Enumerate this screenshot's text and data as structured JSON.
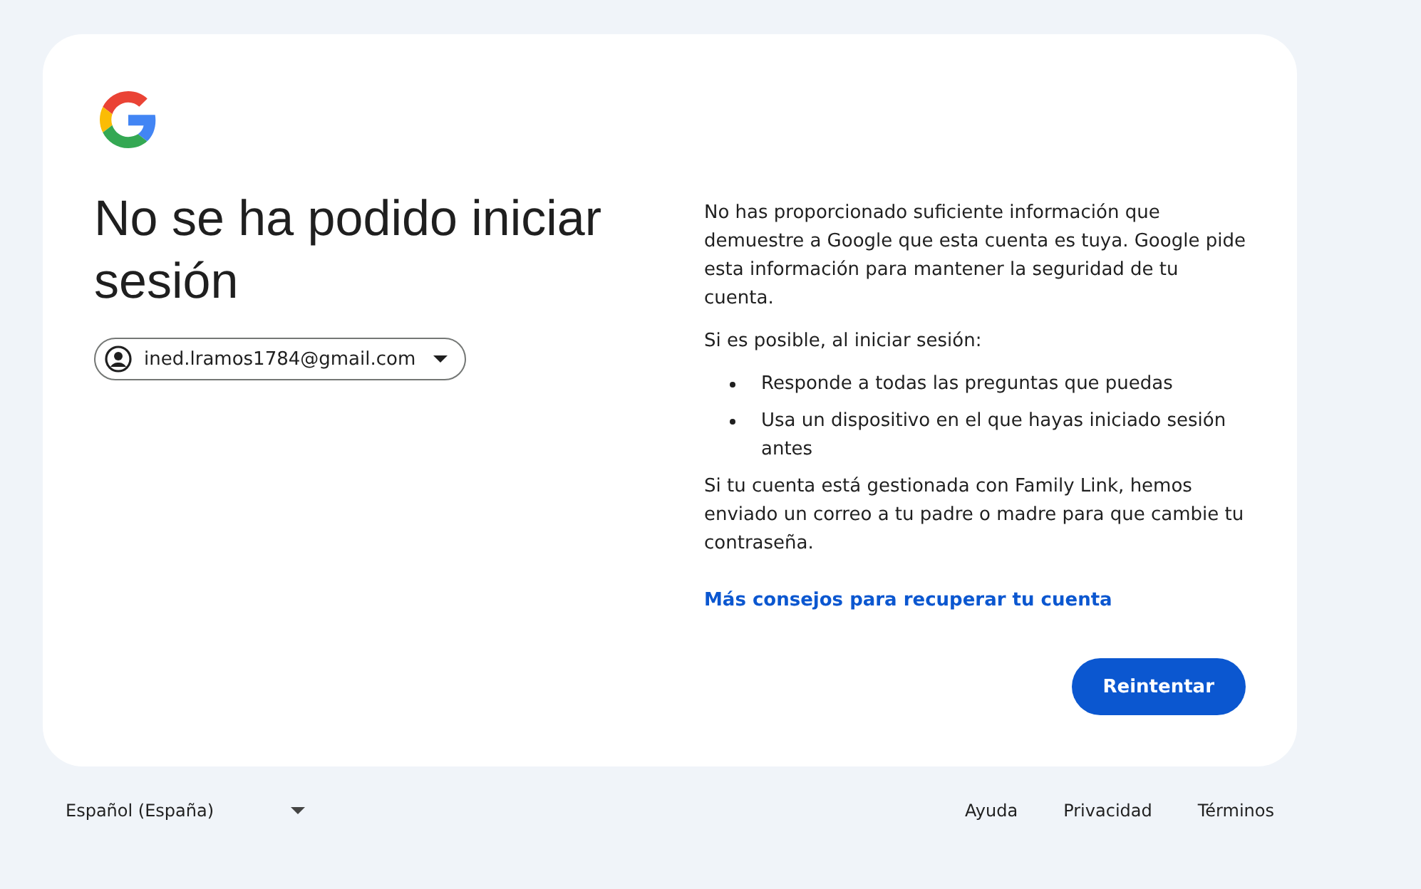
{
  "heading": "No se ha podido iniciar sesión",
  "account": {
    "email": "ined.lramos1784@gmail.com"
  },
  "intro": "No has proporcionado suficiente información que demuestre a Google que esta cuenta es tuya. Google pide esta información para mantener la seguridad de tu cuenta.",
  "tips_title": "Si es posible, al iniciar sesión:",
  "tips": [
    "Responde a todas las preguntas que puedas",
    "Usa un dispositivo en el que hayas iniciado sesión antes"
  ],
  "family_note": "Si tu cuenta está gestionada con Family Link, hemos enviado un correo a tu padre o madre para que cambie tu contraseña.",
  "help_link": "Más consejos para recuperar tu cuenta",
  "retry_button": "Reintentar",
  "footer": {
    "language": "Español (España)",
    "links": [
      "Ayuda",
      "Privacidad",
      "Términos"
    ]
  }
}
